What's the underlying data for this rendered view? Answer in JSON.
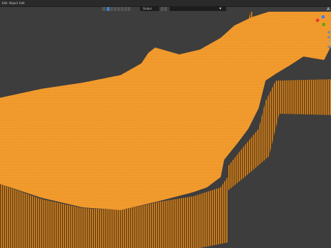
{
  "menu": {
    "items": [
      {
        "label": "Edit"
      },
      {
        "label": "Object"
      },
      {
        "label": "Edit"
      }
    ]
  },
  "header": {
    "dropdown_label": "Global",
    "search_value": ""
  },
  "viewport": {
    "object_color": "#f29b2e",
    "background_color": "#3d3d3d"
  },
  "gizmo": {
    "axes": [
      {
        "axis": "z",
        "color": "#3b82f6"
      },
      {
        "axis": "x",
        "color": "#e53935"
      },
      {
        "axis": "y",
        "color": "#65a30d"
      }
    ],
    "corner_letter": "A"
  },
  "icons": [
    "cursor-icon",
    "select-box-icon",
    "snap-icon",
    "proportional-edit-icon",
    "filter-icon",
    "view-icon",
    "zoom-icon",
    "pan-icon",
    "camera-icon"
  ]
}
